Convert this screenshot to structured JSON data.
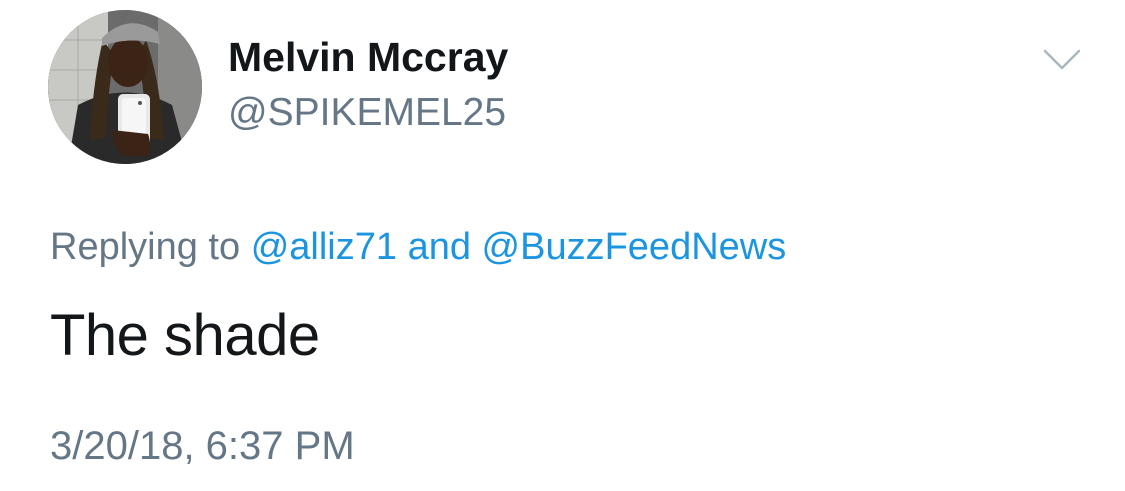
{
  "author": {
    "display_name": "Melvin Mccray",
    "handle": "@SPIKEMEL25",
    "avatar": "profile-photo"
  },
  "menu": {
    "icon": "chevron-down-icon"
  },
  "reply_context": {
    "prefix": "Replying to",
    "mention_1": "@alliz71",
    "conjunction": "and",
    "mention_2": "@BuzzFeedNews"
  },
  "tweet": {
    "text": "The shade",
    "timestamp": "3/20/18, 6:37 PM"
  },
  "colors": {
    "text_primary": "#14171a",
    "text_secondary": "#657786",
    "link": "#1b95e0",
    "chevron": "#aab8c2"
  }
}
